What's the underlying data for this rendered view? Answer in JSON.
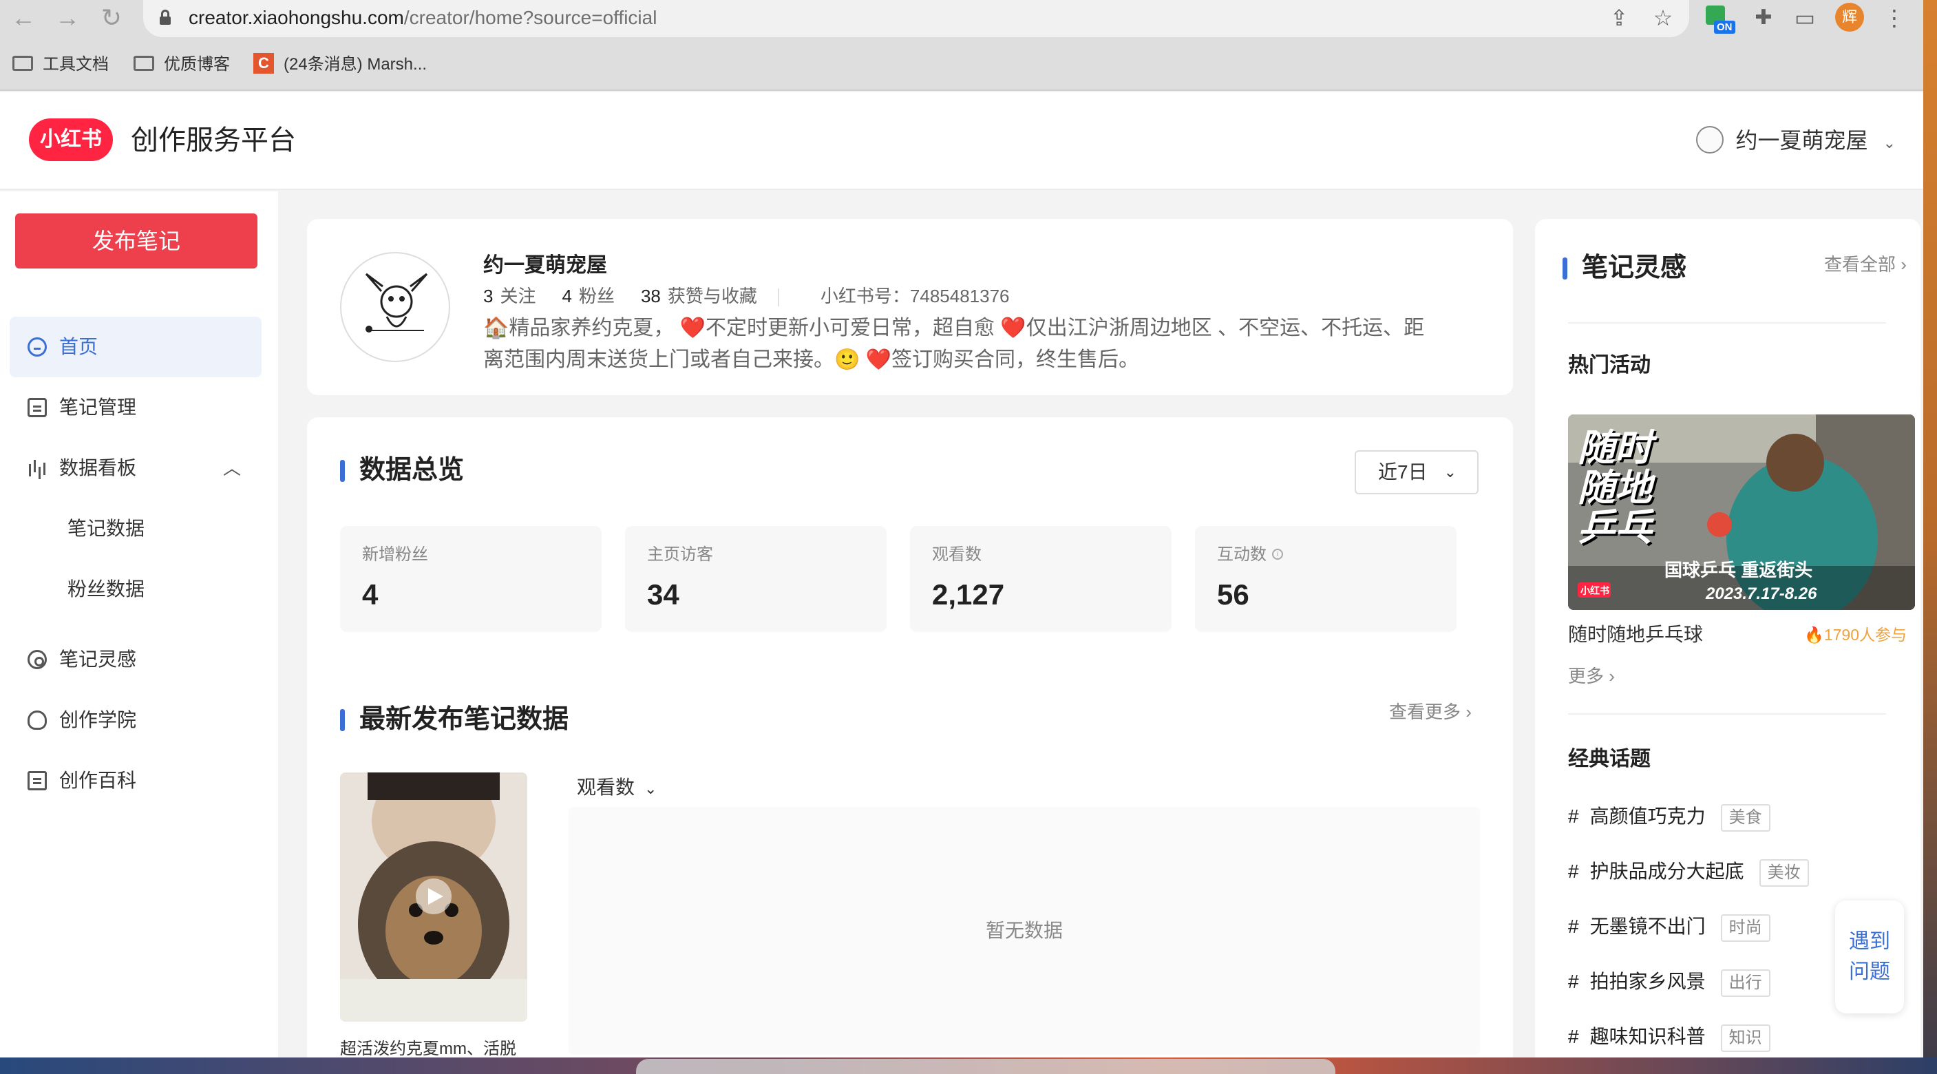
{
  "browser": {
    "url_host": "creator.xiaohongshu.com",
    "url_path": "/creator/home?source=official",
    "extension_badge": "ON",
    "profile_initial": "辉",
    "bookmarks": [
      "工具文档",
      "优质博客",
      "(24条消息) Marsh..."
    ],
    "bookmark_icon_letter": "C"
  },
  "header": {
    "logo_text": "小红书",
    "title": "创作服务平台",
    "user_name": "约一夏萌宠屋"
  },
  "sidebar": {
    "publish_label": "发布笔记",
    "items": [
      {
        "label": "首页",
        "icon": "home-icon",
        "active": true
      },
      {
        "label": "笔记管理",
        "icon": "note-manage-icon"
      },
      {
        "label": "数据看板",
        "icon": "bar-chart-icon",
        "expanded": true
      },
      {
        "label": "笔记数据",
        "sub": true
      },
      {
        "label": "粉丝数据",
        "sub": true
      },
      {
        "label": "笔记灵感",
        "icon": "inspiration-icon"
      },
      {
        "label": "创作学院",
        "icon": "academy-icon"
      },
      {
        "label": "创作百科",
        "icon": "encyclopedia-icon"
      }
    ]
  },
  "profile": {
    "name": "约一夏萌宠屋",
    "following_count": "3",
    "following_label": "关注",
    "fans_count": "4",
    "fans_label": "粉丝",
    "likes_count": "38",
    "likes_label": "获赞与收藏",
    "red_id": "小红书号：7485481376",
    "bio": "🏠精品家养约克夏， ❤️不定时更新小可爱日常，超自愈 ❤️仅出江沪浙周边地区 、不空运、不托运、距离范围内周末送货上门或者自己来接。🙂 ❤️签订购买合同，终生售后。"
  },
  "overview": {
    "title": "数据总览",
    "period": "近7日",
    "metrics": [
      {
        "label": "新增粉丝",
        "value": "4"
      },
      {
        "label": "主页访客",
        "value": "34"
      },
      {
        "label": "观看数",
        "value": "2,127"
      },
      {
        "label": "互动数",
        "value": "56",
        "info": "i"
      }
    ]
  },
  "latest": {
    "title": "最新发布笔记数据",
    "see_more": "查看更多 ›",
    "metric_select": "观看数",
    "empty_text": "暂无数据",
    "note_caption": "超活泼约克夏mm、活脱"
  },
  "inspiration": {
    "title": "笔记灵感",
    "view_all": "查看全部 ›",
    "hot_title": "热门活动",
    "banner_title": "随时随地乒乓球",
    "banner_line1": "随时",
    "banner_line2": "随地",
    "banner_line3": "乒乓",
    "banner_slogan": "国球乒乓 重返街头",
    "banner_date": "2023.7.17-8.26",
    "banner_logo": "小红书",
    "activity_name": "随时随地乒乓球",
    "activity_count": "🔥1790人参与",
    "more": "更多 ›",
    "classic_title": "经典话题",
    "topics": [
      {
        "name": "高颜值巧克力",
        "tag": "美食"
      },
      {
        "name": "护肤品成分大起底",
        "tag": "美妆"
      },
      {
        "name": "无墨镜不出门",
        "tag": "时尚"
      },
      {
        "name": "拍拍家乡风景",
        "tag": "出行"
      },
      {
        "name": "趣味知识科普",
        "tag": "知识"
      }
    ]
  },
  "help": {
    "line1": "遇到",
    "line2": "问题"
  },
  "colors": {
    "brand_red": "#ff2442",
    "publish_red": "#ee3f4d",
    "accent_blue": "#3b6fd6",
    "count_orange": "#f0a23b"
  }
}
